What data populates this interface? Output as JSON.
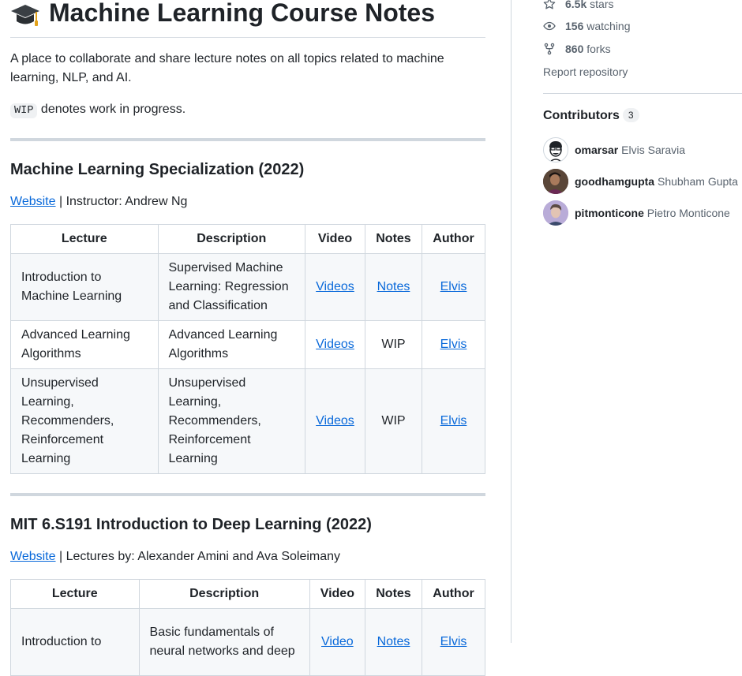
{
  "readme": {
    "title": "Machine Learning Course Notes",
    "intro": "A place to collaborate and share lecture notes on all topics related to machine learning, NLP, and AI.",
    "wip_code": "WIP",
    "wip_text": " denotes work in progress.",
    "sections": [
      {
        "heading": "Machine Learning Specialization (2022)",
        "website_label": "Website",
        "instructor_text": " | Instructor: Andrew Ng",
        "headers": [
          "Lecture",
          "Description",
          "Video",
          "Notes",
          "Author"
        ],
        "rows": [
          {
            "lecture": "Introduction to Machine Learning",
            "description": "Supervised Machine Learning: Regression and Classification",
            "video": "Videos",
            "notes": "Notes",
            "author": "Elvis"
          },
          {
            "lecture": "Advanced Learning Algorithms",
            "description": "Advanced Learning Algorithms",
            "video": "Videos",
            "notes": "WIP",
            "author": "Elvis"
          },
          {
            "lecture": "Unsupervised Learning, Recommenders, Reinforcement Learning",
            "description": "Unsupervised Learning, Recommenders, Reinforcement Learning",
            "video": "Videos",
            "notes": "WIP",
            "author": "Elvis"
          }
        ]
      },
      {
        "heading": "MIT 6.S191 Introduction to Deep Learning (2022)",
        "website_label": "Website",
        "instructor_text": " | Lectures by: Alexander Amini and Ava Soleimany",
        "headers": [
          "Lecture",
          "Description",
          "Video",
          "Notes",
          "Author"
        ],
        "rows": [
          {
            "lecture": "Introduction to",
            "description": "Basic fundamentals of neural networks and deep",
            "video": "Video",
            "notes": "Notes",
            "author": "Elvis"
          }
        ]
      }
    ]
  },
  "sidebar": {
    "stars_count": "6.5k",
    "stars_label": " stars",
    "watching_count": "156",
    "watching_label": " watching",
    "forks_count": "860",
    "forks_label": " forks",
    "report": "Report repository",
    "contributors_title": "Contributors",
    "contributors_count": "3",
    "contributors": [
      {
        "login": "omarsar",
        "name": "Elvis Saravia"
      },
      {
        "login": "goodhamgupta",
        "name": "Shubham Gupta"
      },
      {
        "login": "pitmonticone",
        "name": "Pietro Monticone"
      }
    ]
  },
  "colors": {
    "link": "#0969da",
    "text": "#1f2328",
    "muted": "#59636e",
    "border": "#d0d7de",
    "row_alt": "#f6f8fa"
  },
  "icons": [
    "graduation-cap-icon",
    "star-icon",
    "eye-icon",
    "fork-icon"
  ]
}
